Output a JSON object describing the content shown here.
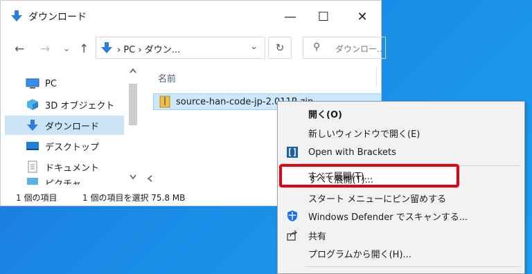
{
  "window": {
    "title": "ダウンロード",
    "minimize_glyph": "—",
    "maximize_glyph": "☐",
    "close_glyph": "✕"
  },
  "address": {
    "back_glyph": "←",
    "forward_glyph": "→",
    "recent_glyph": "⌄",
    "up_glyph": "↑",
    "path": "›  PC  ›  ダウン...",
    "dropdown_glyph": "⌄",
    "refresh_glyph": "↻",
    "search_glyph": "⚲",
    "search_placeholder": "ダウンロー..."
  },
  "nav_pane": {
    "items": [
      {
        "label": "PC",
        "icon": "pc-icon"
      },
      {
        "label": "3D オブジェクト",
        "icon": "3d-objects-icon"
      },
      {
        "label": "ダウンロード",
        "icon": "download-folder-icon",
        "selected": true
      },
      {
        "label": "デスクトップ",
        "icon": "desktop-icon"
      },
      {
        "label": "ドキュメント",
        "icon": "documents-icon"
      },
      {
        "label": "ピクチャ",
        "icon": "pictures-icon"
      }
    ]
  },
  "content": {
    "column_name": "名前",
    "file_name": "source-han-code-jp-2.011R.zip"
  },
  "status": {
    "item_count": "1 個の項目",
    "selection": "1 個の項目を選択  75.8 MB"
  },
  "context_menu": {
    "open": "開く(O)",
    "open_new_window": "新しいウィンドウで開く(E)",
    "open_brackets": "Open with Brackets",
    "extract_all": "すべて展開(T)...",
    "pin_start": "スタート メニューにピン留めする",
    "defender_scan": "Windows Defender でスキャンする...",
    "share": "共有",
    "open_with": "プログラムから開く(H)..."
  },
  "colors": {
    "accent": "#1a73e8",
    "highlight_border": "#e60012",
    "selection": "#cce8ff"
  }
}
